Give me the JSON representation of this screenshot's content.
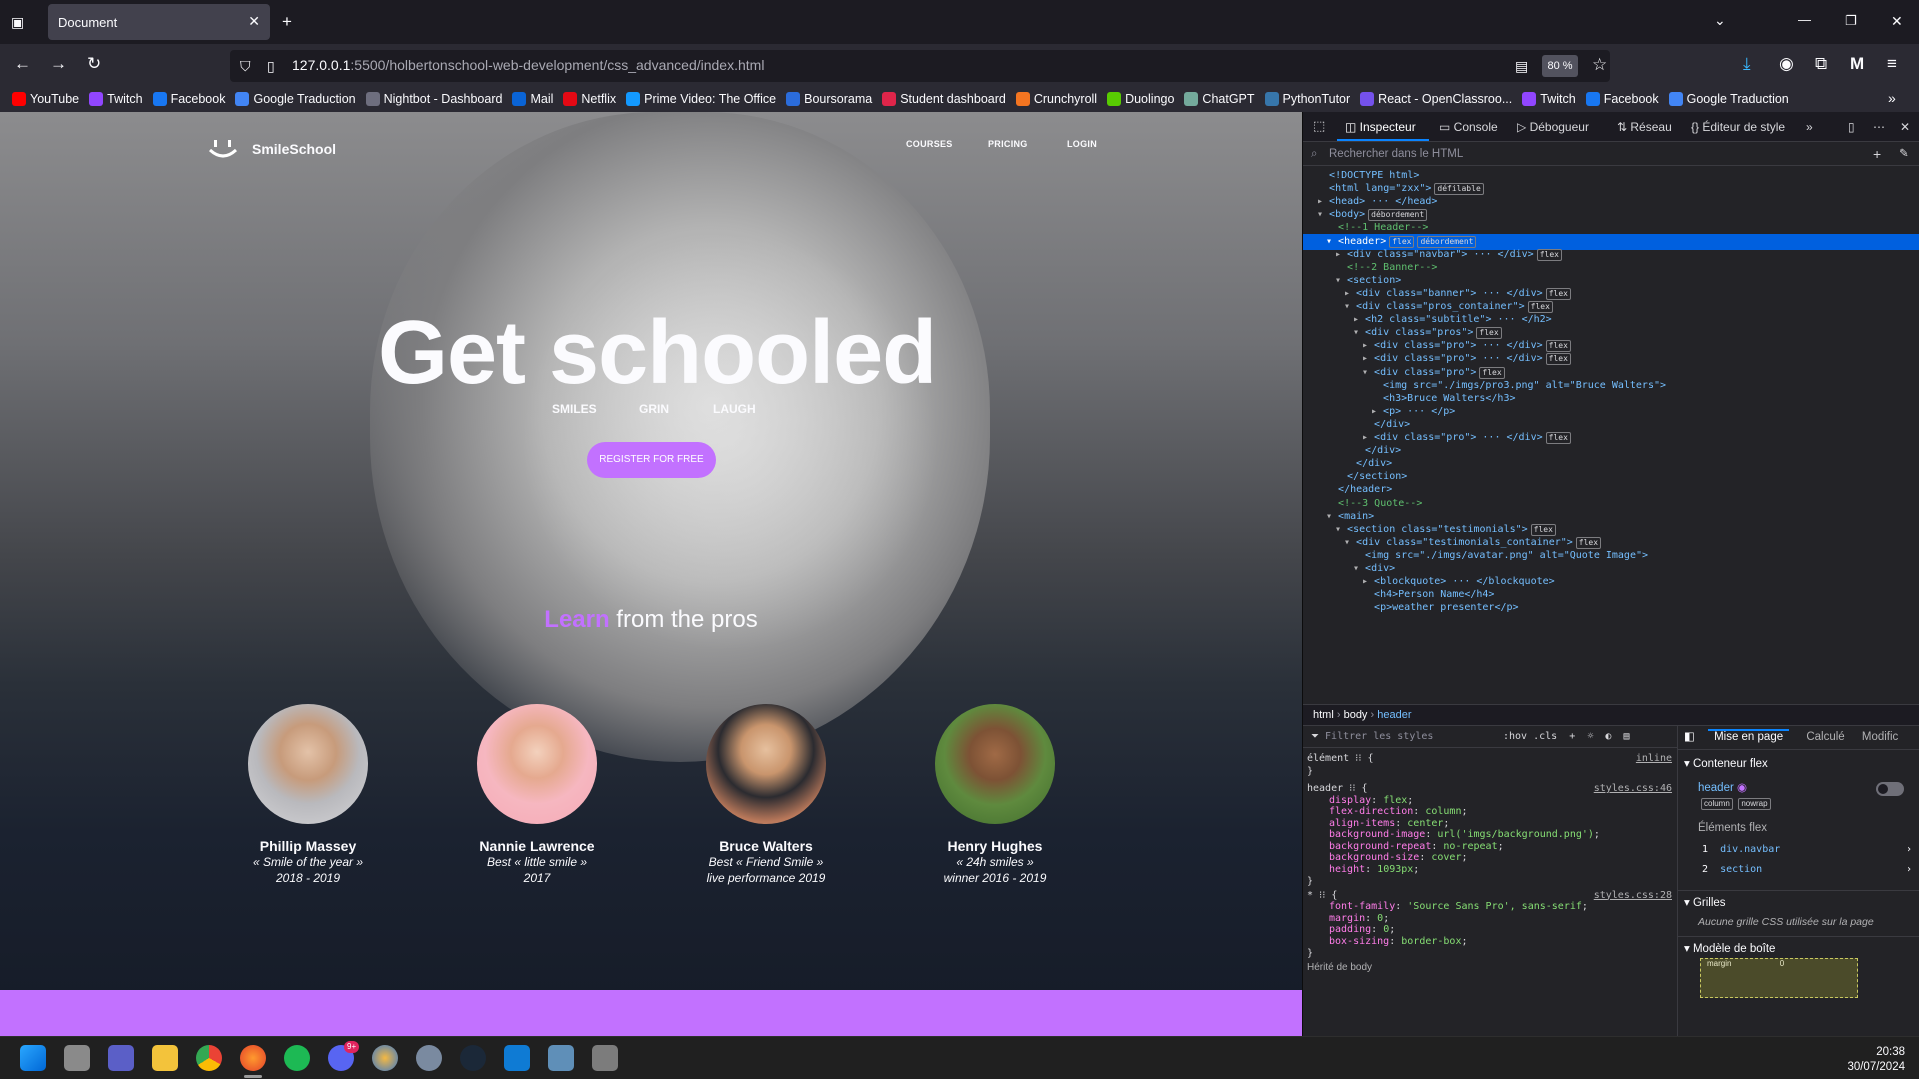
{
  "browser": {
    "tab_title": "Document",
    "url_host": "127.0.0.1",
    "url_rest": ":5500/holbertonschool-web-development/css_advanced/index.html",
    "zoom": "80 %",
    "bookmarks": [
      {
        "label": "YouTube",
        "color": "#ff0000"
      },
      {
        "label": "Twitch",
        "color": "#9146ff"
      },
      {
        "label": "Facebook",
        "color": "#1877f2"
      },
      {
        "label": "Google Traduction",
        "color": "#4285f4"
      },
      {
        "label": "Nightbot - Dashboard",
        "color": "#6e6e7e"
      },
      {
        "label": "Mail",
        "color": "#0a64d6"
      },
      {
        "label": "Netflix",
        "color": "#e50914"
      },
      {
        "label": "Prime Video: The Office",
        "color": "#1399ff"
      },
      {
        "label": "Boursorama",
        "color": "#2b6cdb"
      },
      {
        "label": "Student dashboard",
        "color": "#e0254a"
      },
      {
        "label": "Crunchyroll",
        "color": "#f47521"
      },
      {
        "label": "Duolingo",
        "color": "#58cc02"
      },
      {
        "label": "ChatGPT",
        "color": "#74aa9c"
      },
      {
        "label": "PythonTutor",
        "color": "#3776ab"
      },
      {
        "label": "React - OpenClassroo...",
        "color": "#7451eb"
      },
      {
        "label": "Twitch",
        "color": "#9146ff"
      },
      {
        "label": "Facebook",
        "color": "#1877f2"
      },
      {
        "label": "Google Traduction",
        "color": "#4285f4"
      }
    ]
  },
  "site": {
    "logo": "SmileSchool",
    "nav": [
      "COURSES",
      "PRICING",
      "LOGIN"
    ],
    "hero_title": "Get schooled",
    "hero_words": [
      "SMILES",
      "GRIN",
      "LAUGH"
    ],
    "cta": "REGISTER FOR FREE",
    "learn_accent": "Learn",
    "learn_rest": " from the pros",
    "accent_color": "#c271ff",
    "pros": [
      {
        "name": "Phillip Massey",
        "line1": "« Smile of the year »",
        "line2": "2018 - 2019"
      },
      {
        "name": "Nannie Lawrence",
        "line1": "Best « little smile »",
        "line2": "2017"
      },
      {
        "name": "Bruce Walters",
        "line1": "Best « Friend Smile »",
        "line2": "live performance 2019"
      },
      {
        "name": "Henry Hughes",
        "line1": "« 24h smiles »",
        "line2": "winner 2016 - 2019"
      }
    ]
  },
  "devtools": {
    "tabs": [
      "Inspecteur",
      "Console",
      "Débogueur",
      "Réseau",
      "Éditeur de style"
    ],
    "search_placeholder": "Rechercher dans le HTML",
    "tree": [
      "<!DOCTYPE html>",
      "<html lang=\"zxx\">",
      "<head> ··· </head>",
      "<body>",
      "<!--1 Header-->",
      "<header>",
      "<div class=\"navbar\"> ··· </div>",
      "<!--2 Banner-->",
      "<section>",
      "<div class=\"banner\"> ··· </div>",
      "<div class=\"pros_container\">",
      "<h2 class=\"subtitle\"> ··· </h2>",
      "<div class=\"pros\">",
      "<div class=\"pro\"> ··· </div>",
      "<div class=\"pro\"> ··· </div>",
      "<div class=\"pro\">",
      "<img src=\"./imgs/pro3.png\" alt=\"Bruce Walters\">",
      "<h3>Bruce Walters</h3>",
      "<p> ··· </p>",
      "</div>",
      "<div class=\"pro\"> ··· </div>",
      "</div>",
      "</div>",
      "</section>",
      "</header>",
      "<!--3 Quote-->",
      "<main>",
      "<section class=\"testimonials\">",
      "<div class=\"testimonials_container\">",
      "<img src=\"./imgs/avatar.png\" alt=\"Quote Image\">",
      "<div>",
      "<blockquote> ··· </blockquote>",
      "<h4>Person Name</h4>",
      "<p>weather presenter</p>"
    ],
    "badges": {
      "defilable": "défilable",
      "debordement": "débordement",
      "flex": "flex"
    },
    "breadcrumb": [
      "html",
      "body",
      "header"
    ],
    "filter_placeholder": "Filtrer les styles",
    "filter_tools": [
      ":hov",
      ".cls"
    ],
    "rules": {
      "element_selector": "élément",
      "inline": "inline",
      "header_selector": "header",
      "header_source": "styles.css:46",
      "header_props": [
        [
          "display",
          "flex"
        ],
        [
          "flex-direction",
          "column"
        ],
        [
          "align-items",
          "center"
        ],
        [
          "background-image",
          "url('imgs/background.png')"
        ],
        [
          "background-repeat",
          "no-repeat"
        ],
        [
          "background-size",
          "cover"
        ],
        [
          "height",
          "1093px"
        ]
      ],
      "star_selector": "*",
      "star_source": "styles.css:28",
      "star_props": [
        [
          "font-family",
          "'Source Sans Pro', sans-serif"
        ],
        [
          "margin",
          "0"
        ],
        [
          "padding",
          "0"
        ],
        [
          "box-sizing",
          "border-box"
        ]
      ],
      "inherited": "Hérité de body"
    },
    "layout_tabs": [
      "Mise en page",
      "Calculé",
      "Modific"
    ],
    "flex_title": "Conteneur flex",
    "flex_header": "header",
    "flex_badges": [
      "column",
      "nowrap"
    ],
    "flex_items_title": "Éléments flex",
    "flex_items": [
      "div.navbar",
      "section"
    ],
    "grid_title": "Grilles",
    "grid_text": "Aucune grille CSS utilisée sur la page",
    "box_title": "Modèle de boîte",
    "box_margin": "margin",
    "box_margin_value": "0"
  },
  "taskbar": {
    "time": "20:38",
    "date": "30/07/2024",
    "discord_badge": "9+"
  }
}
